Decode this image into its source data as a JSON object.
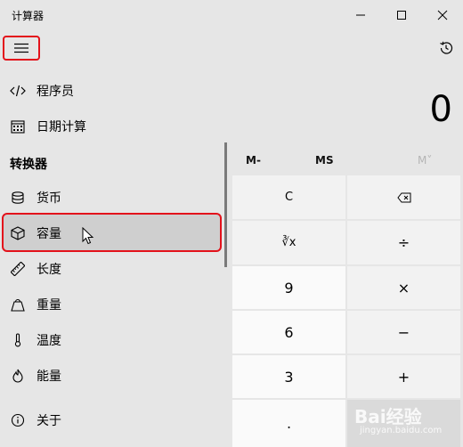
{
  "window": {
    "title": "计算器"
  },
  "display": {
    "value": "0"
  },
  "memory": {
    "m_minus": "M-",
    "ms": "MS",
    "m_view": "M˅"
  },
  "keypad": {
    "clear": "C",
    "backspace_icon": "backspace-icon",
    "cube_root": "∛x",
    "divide": "÷",
    "seven_row": {
      "digit": "9",
      "op": "×"
    },
    "six_row": {
      "digit": "6",
      "op": "−"
    },
    "three_row": {
      "digit": "3",
      "op": "+"
    },
    "dot": "."
  },
  "nav": {
    "items_top": [
      {
        "label": "程序员",
        "icon": "code-icon"
      },
      {
        "label": "日期计算",
        "icon": "calendar-icon"
      }
    ],
    "section_title": "转换器",
    "converters": [
      {
        "label": "货币",
        "icon": "coins-icon"
      },
      {
        "label": "容量",
        "icon": "cube-icon",
        "selected": true
      },
      {
        "label": "长度",
        "icon": "ruler-icon"
      },
      {
        "label": "重量",
        "icon": "weight-icon"
      },
      {
        "label": "温度",
        "icon": "thermometer-icon"
      },
      {
        "label": "能量",
        "icon": "flame-icon"
      }
    ],
    "about": {
      "label": "关于",
      "icon": "info-icon"
    }
  },
  "watermark": {
    "brand": "Bai经验",
    "url": "jingyan.baidu.com"
  },
  "colors": {
    "highlight_border": "#e3121b",
    "background": "#e6e6e6",
    "selected_bg": "#cfcfcf"
  }
}
